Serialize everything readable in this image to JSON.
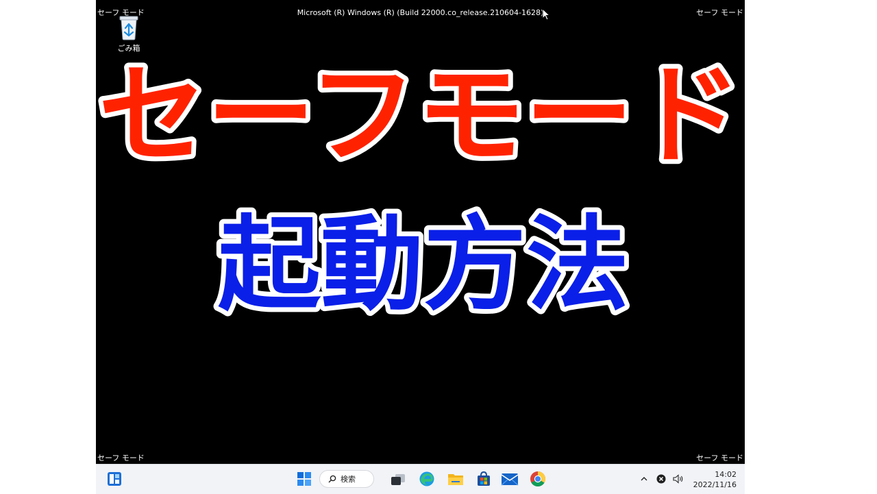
{
  "desktop": {
    "corner_label": "セーフ モード",
    "build_info": "Microsoft (R) Windows (R) (Build 22000.co_release.210604-1628)",
    "icons": [
      {
        "label": "ごみ箱",
        "icon": "recycle-bin-icon"
      }
    ]
  },
  "overlay": {
    "headline": "セーフモード",
    "subheadline": "起動方法",
    "headline_color": "#ff2200",
    "subheadline_color": "#0a1fe8",
    "outline_color": "#ffffff"
  },
  "taskbar": {
    "search_label": "検索",
    "apps": [
      "widgets-icon",
      "start-icon",
      "search-icon",
      "task-view-icon",
      "edge-icon",
      "file-explorer-icon",
      "store-icon",
      "mail-icon",
      "chrome-icon"
    ],
    "tray": [
      "chevron-up-icon",
      "notification-x-icon",
      "volume-icon"
    ],
    "time": "14:02",
    "date": "2022/11/16"
  }
}
